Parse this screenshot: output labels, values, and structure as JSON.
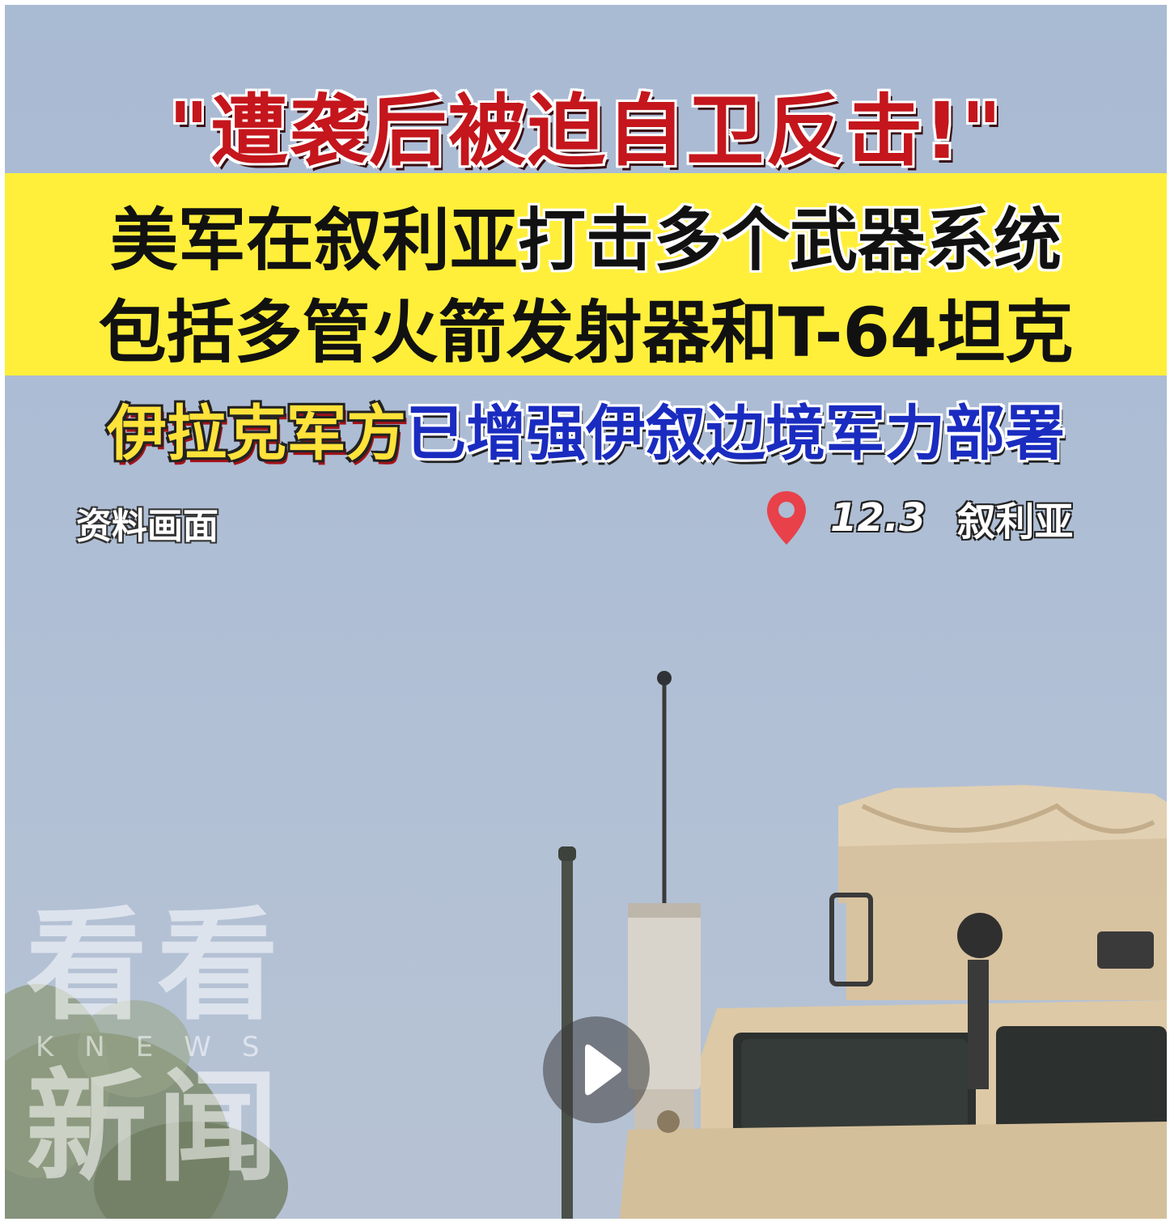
{
  "headline": "\"遭袭后被迫自卫反击!\"",
  "yellow_band": {
    "line1_part1": "美军在叙利亚",
    "line1_part2": "打击多个武器系统",
    "line2": "包括多管火箭发射器和T-64坦克"
  },
  "subheadline": {
    "part1": "伊拉克军方",
    "part2": "已增强伊叙边境军力部署"
  },
  "archive_label": "资料画面",
  "location": {
    "icon": "location-pin-icon",
    "date": "12.3",
    "place": "叙利亚"
  },
  "watermark": {
    "line1": "看看",
    "line2": "KNEWS",
    "line3": "新闻"
  },
  "play_button": {
    "icon": "play-icon"
  },
  "colors": {
    "headline_red": "#c4161c",
    "band_yellow": "#ffef3a",
    "sub_yellow": "#ffe23a",
    "sub_blue": "#1a2cc0",
    "pin_red": "#e8414a",
    "sky": "#adbdd4",
    "vehicle_tan": "#d8c3a0"
  }
}
